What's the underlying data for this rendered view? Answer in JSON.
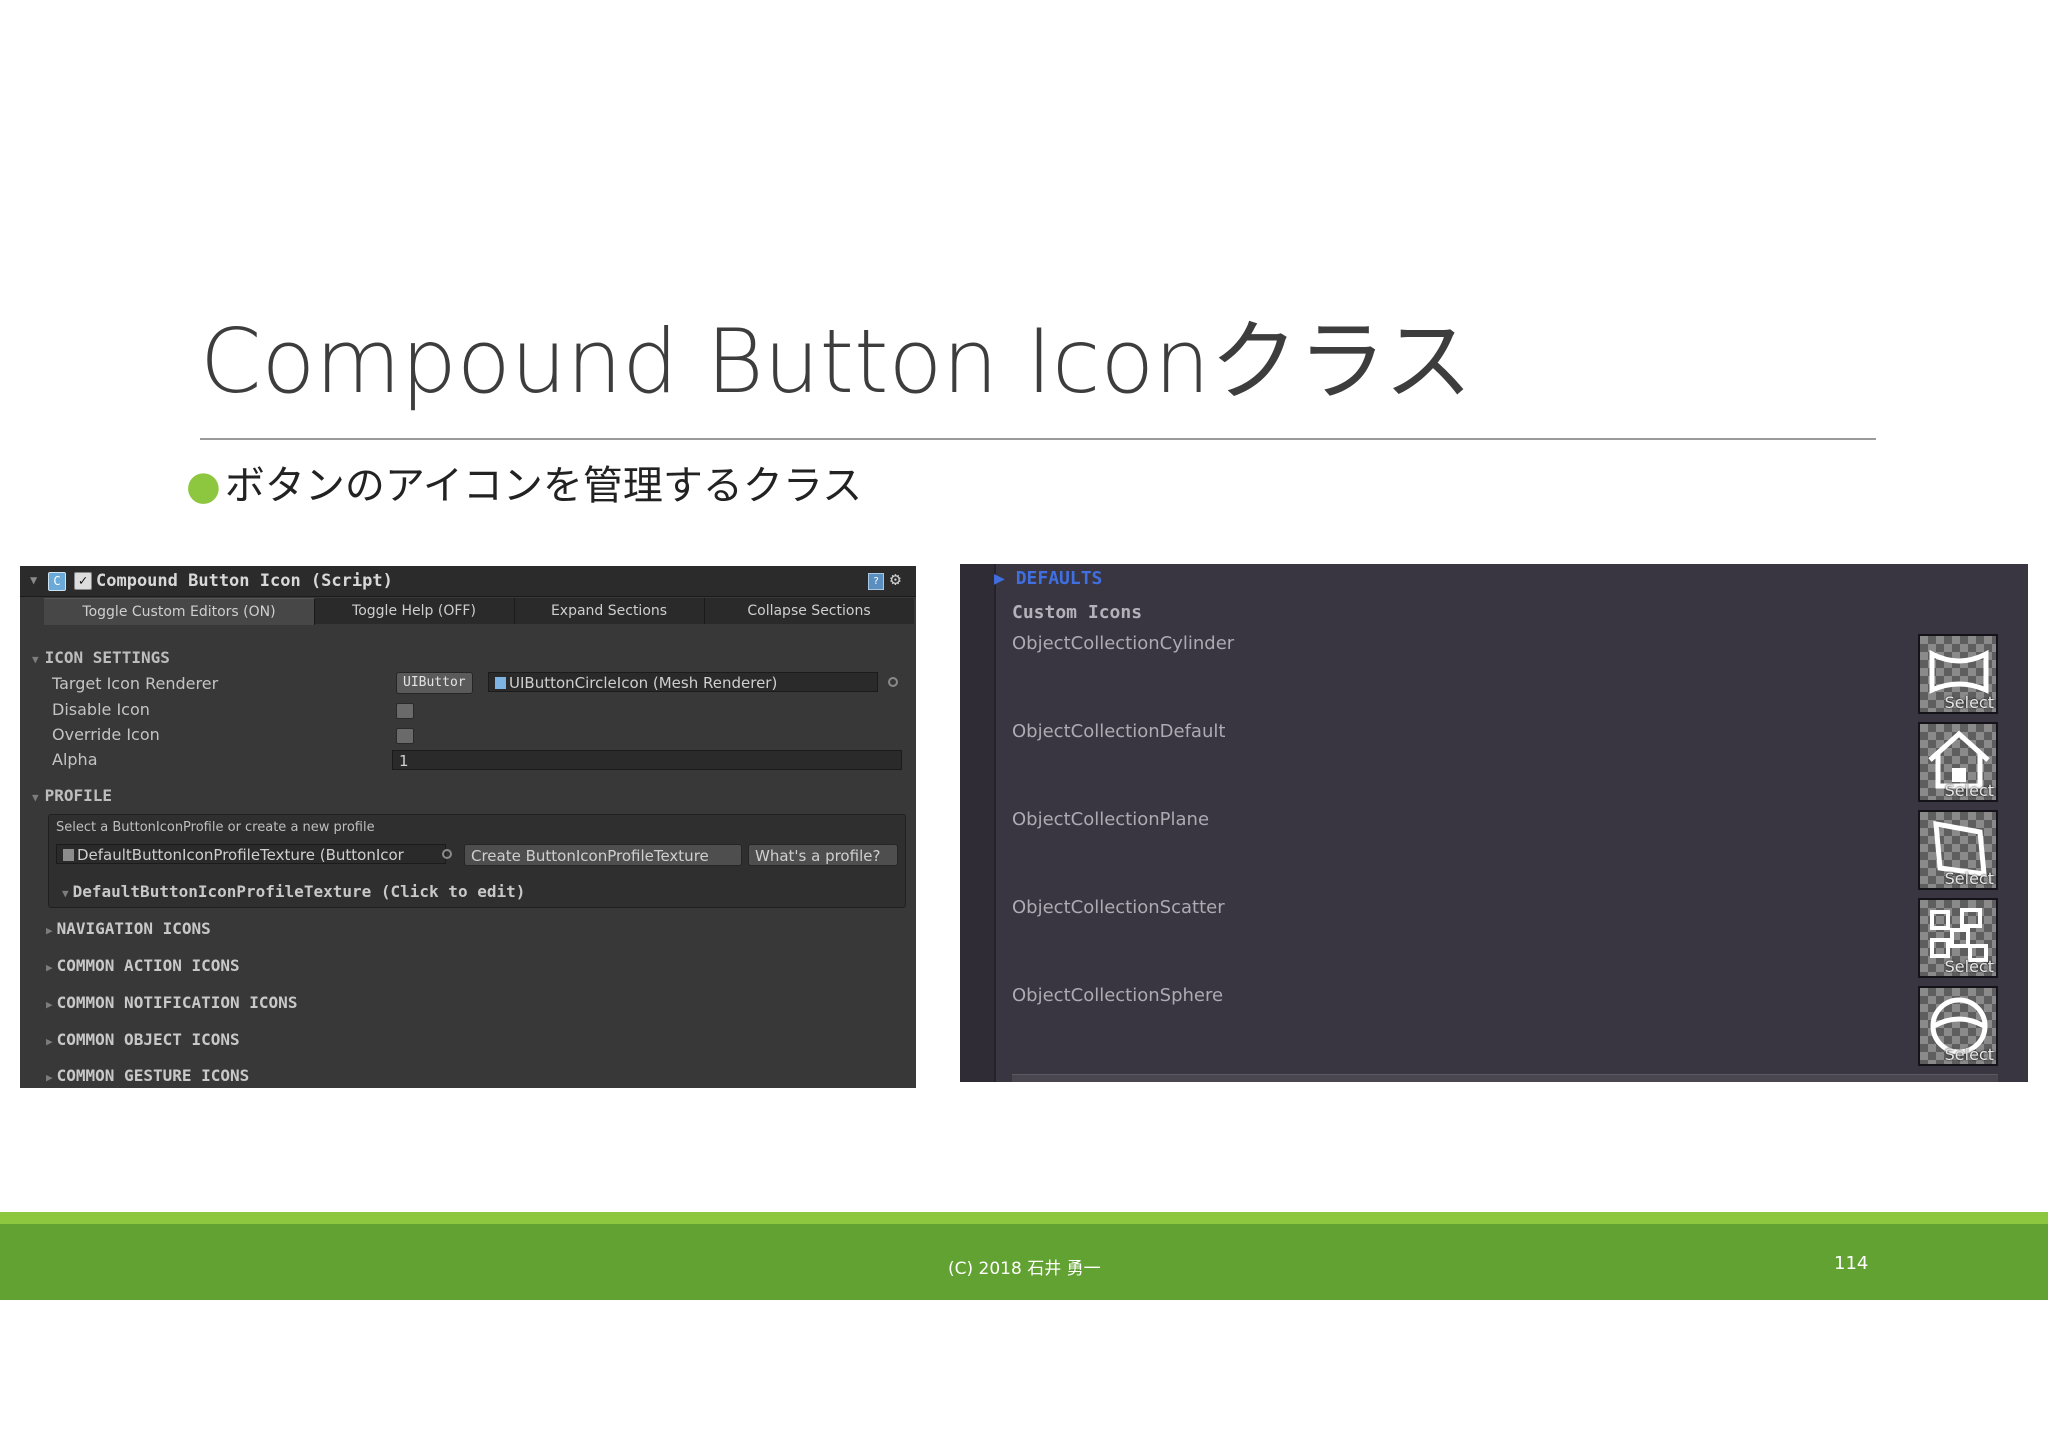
{
  "slide": {
    "title": "Compound Button Iconクラス",
    "bullet": "ボタンのアイコンを管理するクラス",
    "bullet_color": "#8dc63f"
  },
  "inspector": {
    "title": "Compound Button Icon (Script)",
    "toolbar": [
      "Toggle Custom Editors (ON)",
      "Toggle Help (OFF)",
      "Expand Sections",
      "Collapse Sections"
    ],
    "icon_settings": {
      "heading": "ICON SETTINGS",
      "target_icon_renderer_label": "Target Icon Renderer",
      "target_button": "UIButtor",
      "target_value": "UIButtonCircleIcon (Mesh Renderer)",
      "disable_icon_label": "Disable Icon",
      "override_icon_label": "Override Icon",
      "alpha_label": "Alpha",
      "alpha_value": "1"
    },
    "profile": {
      "heading": "PROFILE",
      "help": "Select a ButtonIconProfile or create a new profile",
      "field_value": "DefaultButtonIconProfileTexture (ButtonIcor",
      "create_button": "Create ButtonIconProfileTexture",
      "whats_button": "What's a profile?",
      "profile_foldout": "DefaultButtonIconProfileTexture (Click to edit)"
    },
    "foldouts": [
      "NAVIGATION ICONS",
      "COMMON ACTION ICONS",
      "COMMON NOTIFICATION ICONS",
      "COMMON OBJECT ICONS",
      "COMMON GESTURE ICONS"
    ]
  },
  "icons_panel": {
    "defaults_heading": "DEFAULTS",
    "custom_heading": "Custom Icons",
    "select_label": "Select",
    "items": [
      {
        "label": "ObjectCollectionCylinder",
        "icon": "cylinder-icon"
      },
      {
        "label": "ObjectCollectionDefault",
        "icon": "house-icon"
      },
      {
        "label": "ObjectCollectionPlane",
        "icon": "plane-icon"
      },
      {
        "label": "ObjectCollectionScatter",
        "icon": "scatter-icon"
      },
      {
        "label": "ObjectCollectionSphere",
        "icon": "sphere-icon"
      }
    ]
  },
  "footer": {
    "copyright": "(C) 2018 石井 勇一",
    "page_number": "114",
    "colors": {
      "light": "#8dc63f",
      "main": "#62a232"
    }
  }
}
